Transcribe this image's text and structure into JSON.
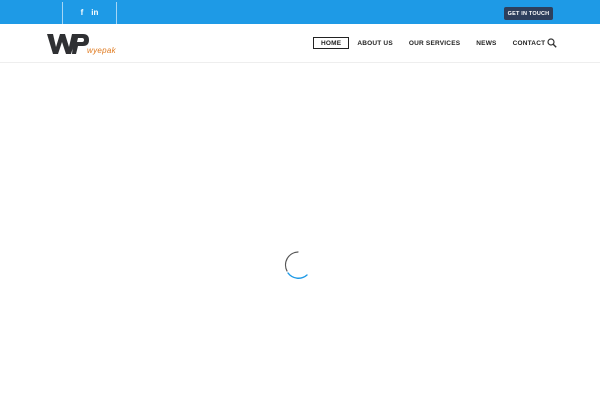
{
  "topbar": {
    "color": "#1e9ae6",
    "social": [
      {
        "icon": "facebook-icon",
        "glyph": "f"
      },
      {
        "icon": "linkedin-icon",
        "glyph": "in"
      }
    ],
    "cta_label": "GET IN TOUCH"
  },
  "header": {
    "logo": {
      "mark": "WP",
      "wordmark": "wyepak"
    },
    "nav": [
      {
        "label": "HOME",
        "active": true
      },
      {
        "label": "ABOUT US"
      },
      {
        "label": "OUR SERVICES"
      },
      {
        "label": "NEWS"
      },
      {
        "label": "CONTACT"
      }
    ],
    "search_icon": "search-icon"
  },
  "loader": {
    "icon": "loading-spinner-icon",
    "color": "#1e9ae6"
  }
}
